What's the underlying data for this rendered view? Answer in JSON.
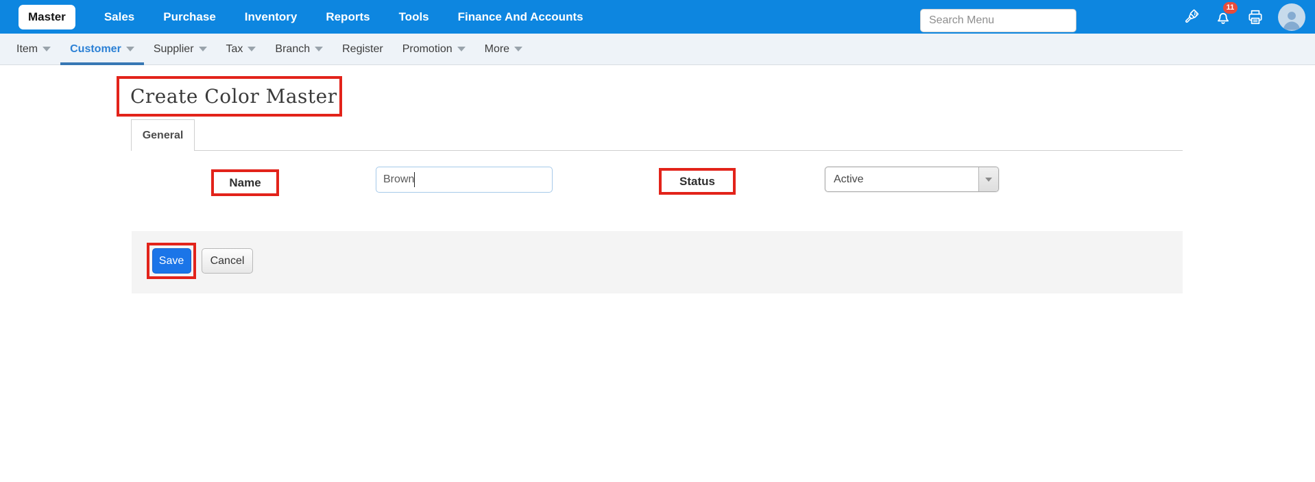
{
  "top_nav": {
    "items": [
      {
        "label": "Master",
        "active": true
      },
      {
        "label": "Sales"
      },
      {
        "label": "Purchase"
      },
      {
        "label": "Inventory"
      },
      {
        "label": "Reports"
      },
      {
        "label": "Tools"
      },
      {
        "label": "Finance And Accounts"
      }
    ],
    "search": {
      "placeholder": "Search Menu"
    },
    "notification_badge": "11",
    "icons": [
      "paintbrush-icon",
      "bell-icon",
      "printer-icon",
      "avatar"
    ]
  },
  "sub_nav": {
    "items": [
      {
        "label": "Item",
        "caret": true
      },
      {
        "label": "Customer",
        "caret": true,
        "active": true
      },
      {
        "label": "Supplier",
        "caret": true
      },
      {
        "label": "Tax",
        "caret": true
      },
      {
        "label": "Branch",
        "caret": true
      },
      {
        "label": "Register",
        "caret": false
      },
      {
        "label": "Promotion",
        "caret": true
      },
      {
        "label": "More",
        "caret": true
      }
    ]
  },
  "page": {
    "title": "Create Color Master",
    "tabs": [
      {
        "label": "General",
        "active": true
      }
    ]
  },
  "form": {
    "fields": [
      {
        "label": "Name",
        "type": "text",
        "value": "Brown"
      },
      {
        "label": "Status",
        "type": "select",
        "value": "Active"
      }
    ]
  },
  "actions": {
    "save_label": "Save",
    "cancel_label": "Cancel"
  },
  "colors": {
    "topbar_blue": "#0d86e0",
    "annotation_red": "#e2231a",
    "save_blue": "#1b75e8",
    "active_link_blue": "#2b80d5",
    "badge_red": "#e74c3c"
  }
}
